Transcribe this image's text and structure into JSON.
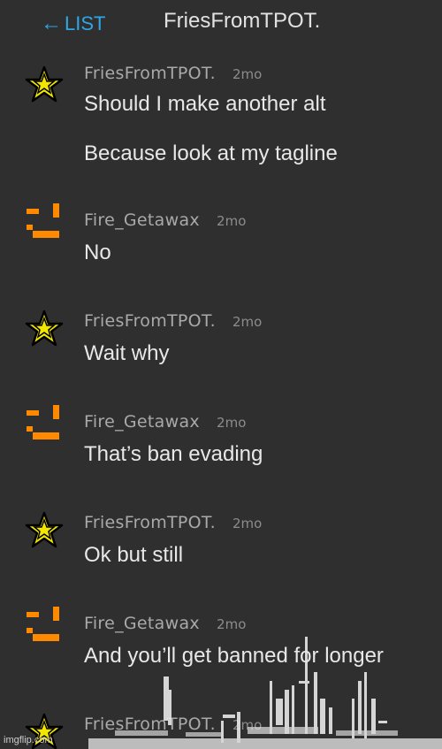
{
  "header": {
    "back_label": "LIST",
    "back_arrow": "←",
    "title": "FriesFromTPOT."
  },
  "messages": [
    {
      "avatar": "star-icon",
      "username": "FriesFromTPOT.",
      "time": "2mo",
      "lines": [
        "Should I make another alt",
        "Because look at my tagline"
      ]
    },
    {
      "avatar": "pixel-face-icon",
      "username": "Fire_Getawax",
      "time": "2mo",
      "lines": [
        "No"
      ]
    },
    {
      "avatar": "star-icon",
      "username": "FriesFromTPOT.",
      "time": "2mo",
      "lines": [
        "Wait why"
      ]
    },
    {
      "avatar": "pixel-face-icon",
      "username": "Fire_Getawax",
      "time": "2mo",
      "lines": [
        "That’s ban evading"
      ]
    },
    {
      "avatar": "star-icon",
      "username": "FriesFromTPOT.",
      "time": "2mo",
      "lines": [
        "Ok but still"
      ]
    },
    {
      "avatar": "pixel-face-icon",
      "username": "Fire_Getawax",
      "time": "2mo",
      "lines": [
        "And you’ll get banned for longer"
      ]
    },
    {
      "avatar": "star-icon",
      "username": "FriesFromTPOT.",
      "time": "2mo",
      "lines": []
    }
  ],
  "watermark": "imgflip.com",
  "colors": {
    "background": "#2f2f2f",
    "accent": "#2ea7e6",
    "star_fill": "#f2e600",
    "face_orange": "#ff8a00"
  }
}
